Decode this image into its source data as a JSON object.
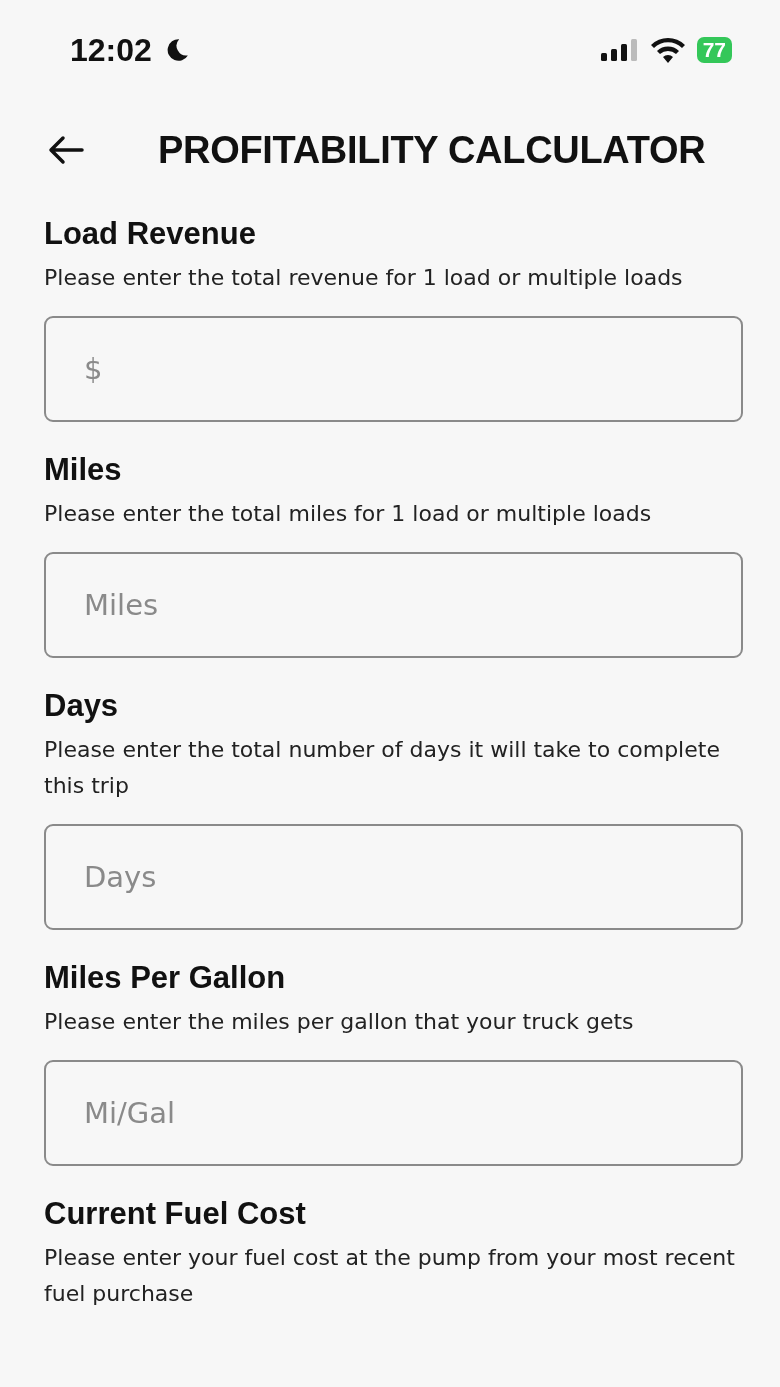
{
  "status_bar": {
    "time": "12:02",
    "battery": "77"
  },
  "header": {
    "title": "PROFITABILITY CALCULATOR"
  },
  "fields": [
    {
      "label": "Load Revenue",
      "hint": "Please enter the total revenue for 1 load or multiple loads",
      "placeholder": "$"
    },
    {
      "label": "Miles",
      "hint": "Please enter the total miles for 1 load or multiple loads",
      "placeholder": "Miles"
    },
    {
      "label": "Days",
      "hint": "Please enter the total number of days it will take to complete this trip",
      "placeholder": "Days"
    },
    {
      "label": "Miles Per Gallon",
      "hint": "Please enter the miles per gallon that your truck gets",
      "placeholder": "Mi/Gal"
    },
    {
      "label": "Current Fuel Cost",
      "hint": "Please enter your fuel cost at the pump from your most recent fuel purchase"
    }
  ]
}
